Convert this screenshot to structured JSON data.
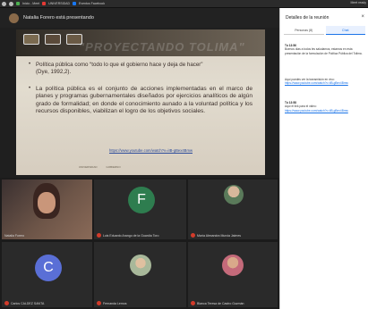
{
  "browser": {
    "tab1": "Inicio - Meet",
    "tab2": "UNIVERSIDAD",
    "tab3": "Eventos Facebook",
    "right_text": "Meet ready"
  },
  "presenter": {
    "text": "Natalia Forero está presentando"
  },
  "slide": {
    "watermark": "\"PROYECTANDO TOLIMA\"",
    "bullet1": "Política pública como “todo lo que el gobierno hace y deja de hacer” (Dye, 1992,2).",
    "bullet2": "La política pública es el conjunto de acciones implementadas en el marco de planes y programas gubernamentales diseñados por ejercicios analíticos de algún grado de formalidad; en donde el conocimiento aunado a la voluntad política y los recursos disponibles, viabilizan el logro de los objetivos sociales.",
    "link": "https://www.youtube.com/watch?v=iIB-gBex4Bmw",
    "footer_left": "UNIVERSIDAD",
    "footer_right": "GOBIERNO"
  },
  "participants": [
    {
      "name": "Natalia Forero"
    },
    {
      "name": "Luis Eduardo Arango de la Guardia Toro"
    },
    {
      "name": "María Alexandra Murcia Jaimes"
    },
    {
      "name": "Carlos CALDEZ SANTA"
    },
    {
      "name": "Fernanda Lemos"
    },
    {
      "name": "Blanca Teresa de Castro Guzmán"
    }
  ],
  "avatar_letters": {
    "p2": "F",
    "p4": "C"
  },
  "colors": {
    "avatar_green": "#2e7d4f",
    "avatar_blue": "#5a6fd6",
    "mic_off": "#d23b2a",
    "accent": "#1a73e8"
  },
  "panel": {
    "title": "Detalles de la reunión",
    "close": "×",
    "tab_people": "Personas (8)",
    "tab_chat": "Chat",
    "msg1_who": "Tú  13:56",
    "msg1_text": "Buenos días a todos les saludamos, estamos en esta presentación de la formulación de Política Pública del Tolima.",
    "msg2_who": "Tú  13:57",
    "msg2_text": "Aquí puedes ver la transmisión en vivo:",
    "msg2_link": "https://www.youtube.com/watch?v=iIB-gBex4Bmw",
    "msg3_who": "Tú  13:58",
    "msg3_text": "Aquí el link para el video:",
    "msg3_link": "https://www.youtube.com/watch?v=iIB-gBex4Bmw"
  }
}
